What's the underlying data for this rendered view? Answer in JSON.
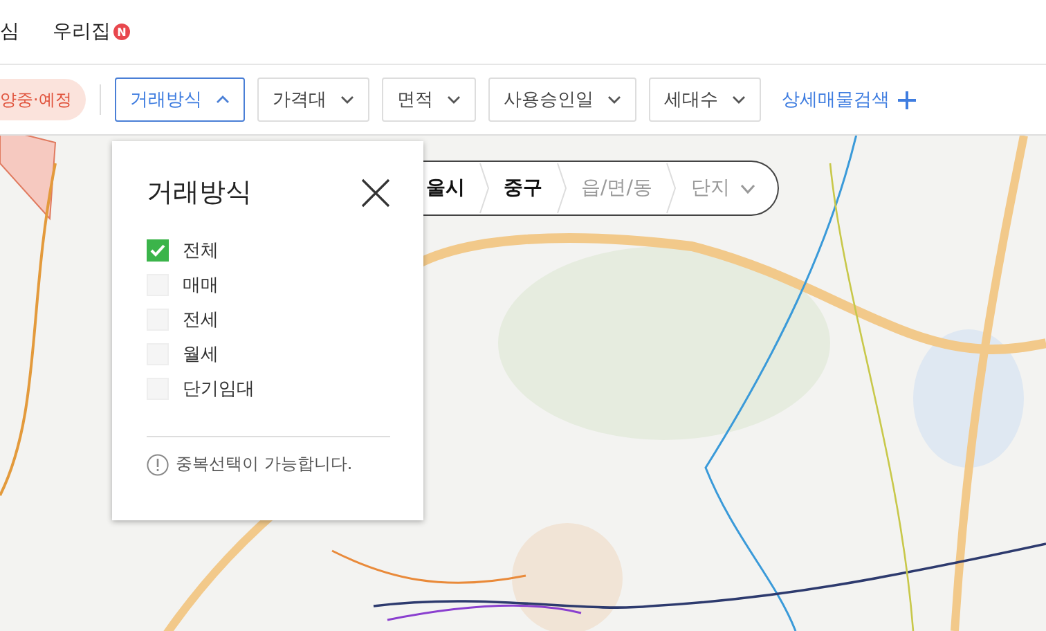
{
  "top_nav": [
    {
      "label": "심"
    },
    {
      "label": "우리집",
      "badge": "N"
    }
  ],
  "filters": {
    "status_chip": "양중·예정",
    "buttons": [
      {
        "label": "거래방식",
        "selected": true
      },
      {
        "label": "가격대",
        "selected": false
      },
      {
        "label": "면적",
        "selected": false
      },
      {
        "label": "사용승인일",
        "selected": false
      },
      {
        "label": "세대수",
        "selected": false
      }
    ],
    "detail_search": "상세매물검색"
  },
  "breadcrumb": [
    {
      "label": "울시",
      "active": true,
      "expandable": false
    },
    {
      "label": "중구",
      "active": true,
      "expandable": false
    },
    {
      "label": "읍/면/동",
      "active": false,
      "expandable": false
    },
    {
      "label": "단지",
      "active": false,
      "expandable": true
    }
  ],
  "popup": {
    "title": "거래방식",
    "options": [
      {
        "label": "전체",
        "checked": true
      },
      {
        "label": "매매",
        "checked": false
      },
      {
        "label": "전세",
        "checked": false
      },
      {
        "label": "월세",
        "checked": false
      },
      {
        "label": "단기임대",
        "checked": false
      }
    ],
    "note": "중복선택이 가능합니다."
  }
}
